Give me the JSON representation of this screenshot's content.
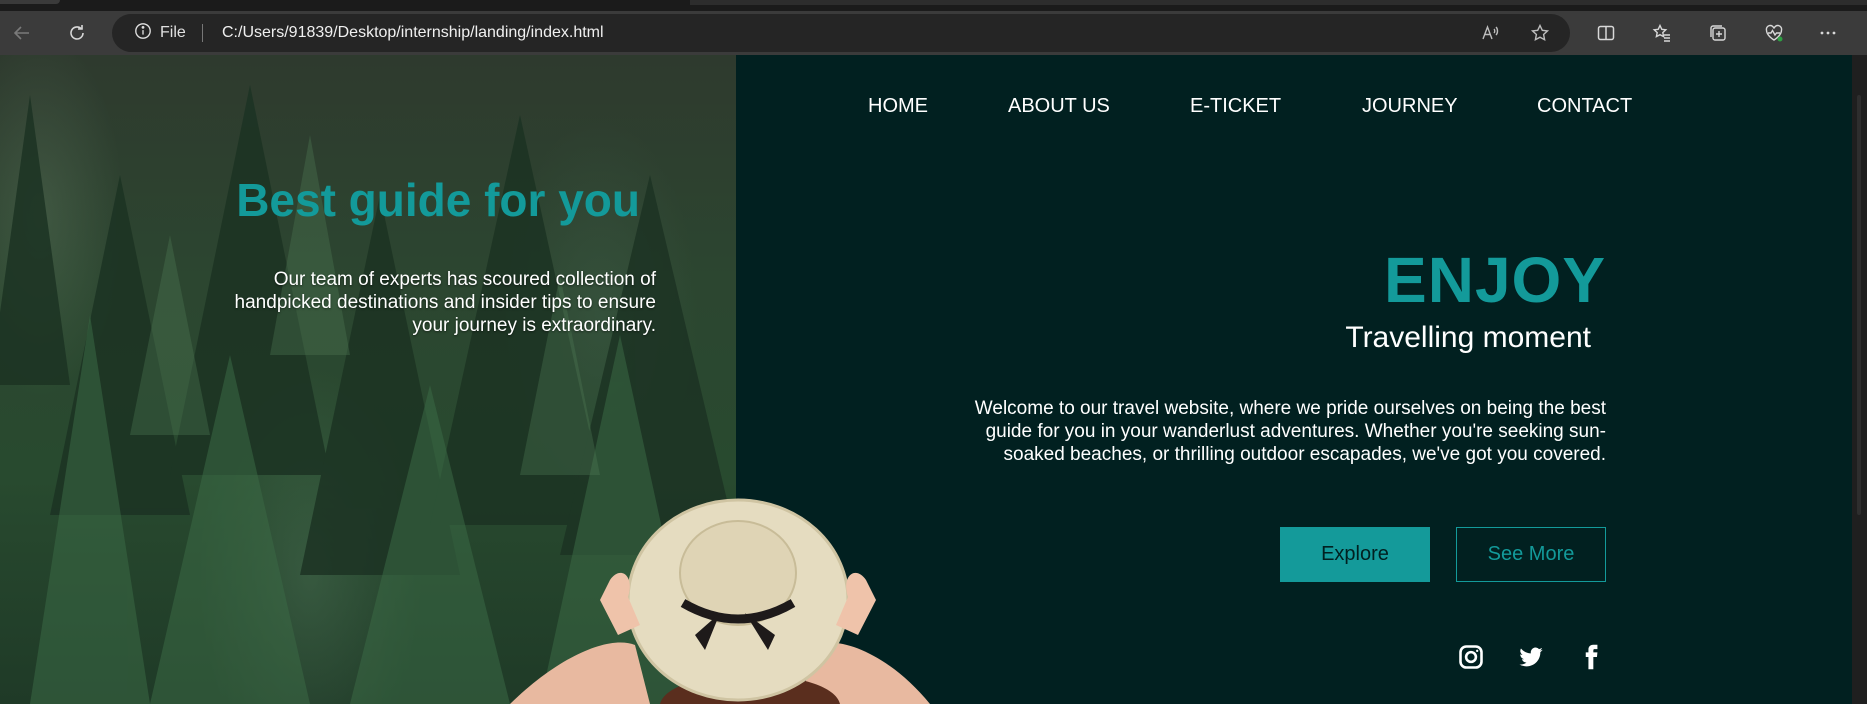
{
  "browser": {
    "address": {
      "scheme_label": "File",
      "url": "C:/Users/91839/Desktop/internship/landing/index.html"
    },
    "icons": [
      "back-icon",
      "refresh-icon",
      "info-icon",
      "read-aloud-icon",
      "favorite-star-icon",
      "split-screen-icon",
      "favorites-icon",
      "collections-icon",
      "browser-essentials-icon",
      "more-icon"
    ]
  },
  "nav": {
    "items": [
      {
        "label": "HOME"
      },
      {
        "label": "ABOUT US"
      },
      {
        "label": "E-TICKET"
      },
      {
        "label": "JOURNEY"
      },
      {
        "label": "CONTACT"
      }
    ]
  },
  "left": {
    "title": "Best guide for you",
    "text": "Our team of experts has scoured collection of handpicked destinations and insider tips to ensure your journey is extraordinary."
  },
  "hero": {
    "headline": "ENJOY",
    "subtitle": "Travelling moment",
    "text": "Welcome to our travel website, where we pride ourselves on being the best guide for you in your wanderlust adventures. Whether you're seeking sun-soaked beaches, or thrilling outdoor escapades, we've got you covered.",
    "explore_label": "Explore",
    "see_more_label": "See More"
  },
  "social": [
    "instagram-icon",
    "twitter-icon",
    "facebook-icon"
  ],
  "colors": {
    "accent": "#139a9a",
    "panel": "#012020",
    "text": "#ffffff"
  }
}
